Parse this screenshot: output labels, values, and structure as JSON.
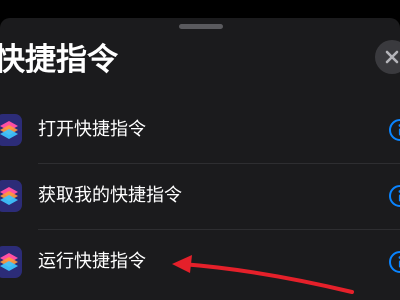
{
  "sheet": {
    "title": "快捷指令"
  },
  "actions": [
    {
      "label": "打开快捷指令",
      "icon": "shortcuts-app-icon"
    },
    {
      "label": "获取我的快捷指令",
      "icon": "shortcuts-app-icon"
    },
    {
      "label": "运行快捷指令",
      "icon": "shortcuts-app-icon"
    }
  ],
  "colors": {
    "background": "#000000",
    "sheet": "#1b1b1d",
    "info_accent": "#0a84ff",
    "annotation_arrow": "#e5202a"
  }
}
